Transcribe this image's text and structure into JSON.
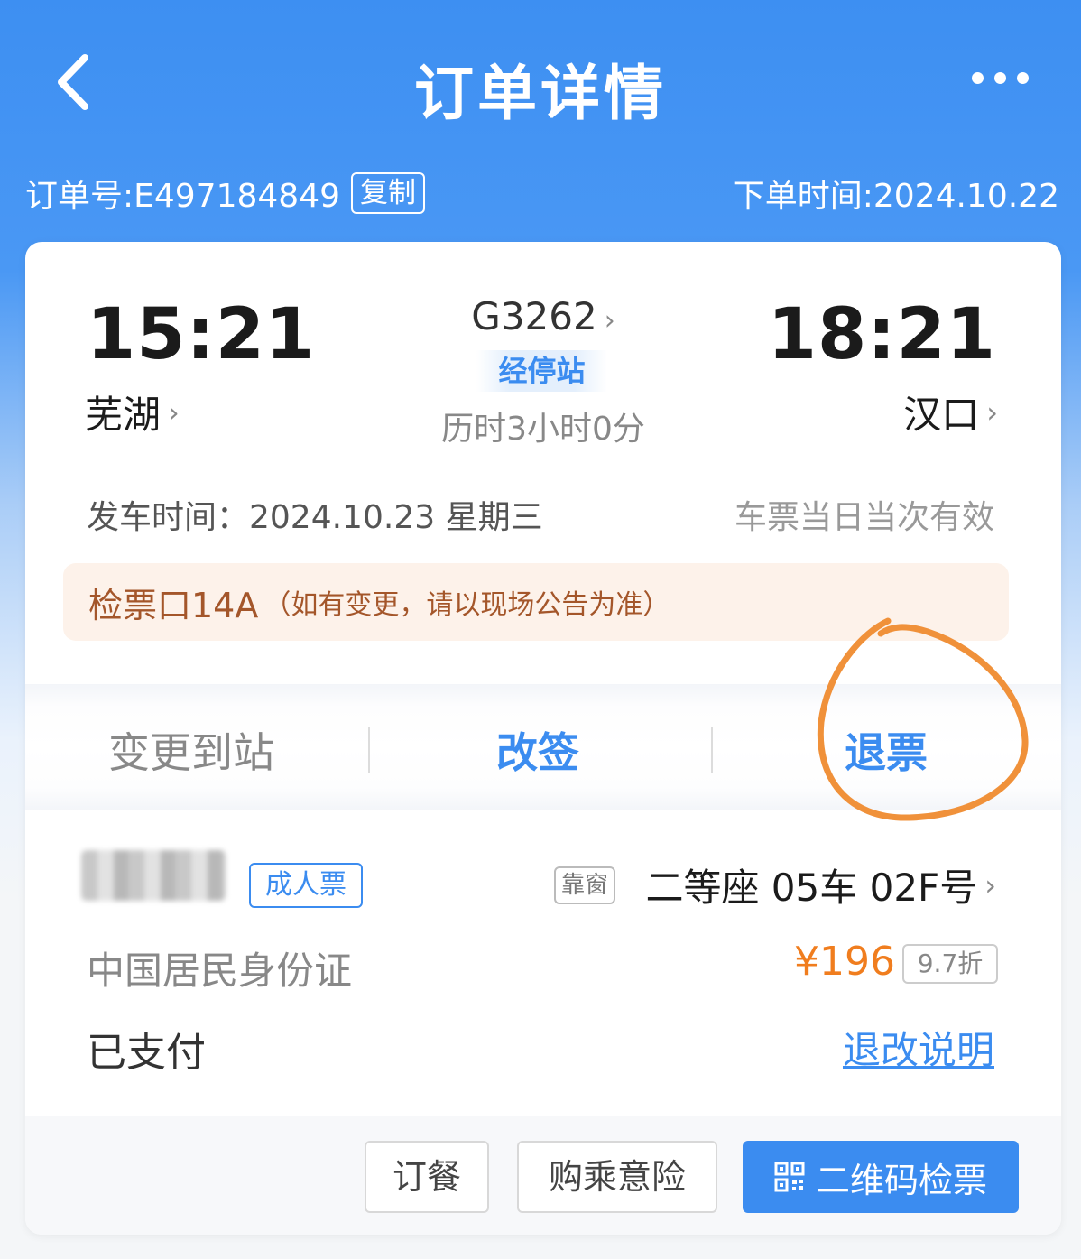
{
  "header": {
    "title": "订单详情",
    "back_icon": "chevron-left-icon",
    "more_icon": "more-dots-icon"
  },
  "order": {
    "order_no": "订单号:E497184849",
    "copy_label": "复制",
    "order_time": "下单时间:2024.10.22"
  },
  "trip": {
    "departure_time": "15:21",
    "departure_station": "芜湖",
    "train_no": "G3262",
    "stops_label": "经停站",
    "duration": "历时3小时0分",
    "arrival_time": "18:21",
    "arrival_station": "汉口",
    "depart_date": "发车时间：2024.10.23 星期三",
    "validity": "车票当日当次有效"
  },
  "gate": {
    "main": "检票口14A",
    "note": "（如有变更，请以现场公告为准）"
  },
  "actions": {
    "change_station": "变更到站",
    "reschedule": "改签",
    "refund": "退票"
  },
  "passenger": {
    "ticket_type": "成人票",
    "window_tag": "靠窗",
    "seat": "二等座 05车 02F号",
    "id_type": "中国居民身份证",
    "price": "¥196",
    "discount": "9.7折",
    "payment_status": "已支付",
    "refund_policy": "退改说明"
  },
  "bottom_buttons": {
    "meal": "订餐",
    "insurance": "购乘意险",
    "qr_check": "二维码检票"
  },
  "colors": {
    "accent": "#3b8cf0",
    "price": "#f07d1e",
    "gate_text": "#a4562a",
    "annotation": "#f0913a"
  }
}
